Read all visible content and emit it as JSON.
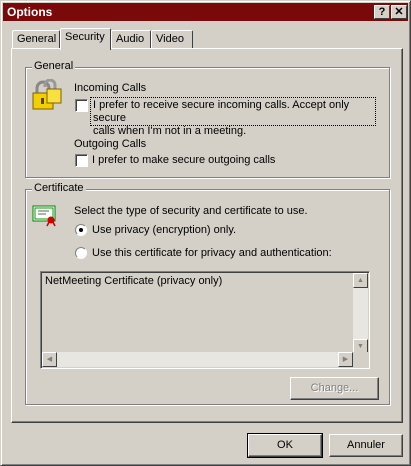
{
  "window": {
    "title": "Options",
    "help_glyph": "?",
    "close_glyph": "✕"
  },
  "tabs": [
    {
      "label": "General"
    },
    {
      "label": "Security"
    },
    {
      "label": "Audio"
    },
    {
      "label": "Video"
    }
  ],
  "general_group": {
    "legend": "General",
    "incoming_heading": "Incoming Calls",
    "incoming_checkbox": {
      "checked": false,
      "line1": "I prefer to receive secure incoming calls. Accept only secure",
      "line2": "calls when I'm not in a meeting."
    },
    "outgoing_heading": "Outgoing Calls",
    "outgoing_checkbox": {
      "checked": false,
      "label": "I prefer to make secure outgoing calls"
    }
  },
  "certificate_group": {
    "legend": "Certificate",
    "description": "Select the type of security and certificate to use.",
    "radio_privacy": {
      "label": "Use privacy (encryption) only.",
      "checked": true
    },
    "radio_certificate": {
      "label": "Use this certificate for privacy and authentication:",
      "checked": false
    },
    "certificate_list": [
      "NetMeeting Certificate (privacy only)"
    ],
    "change_button": "Change..."
  },
  "footer": {
    "ok_label": "OK",
    "cancel_label": "Annuler"
  },
  "colors": {
    "titlebar": "#7a0a0a",
    "face": "#d4d0c8"
  }
}
